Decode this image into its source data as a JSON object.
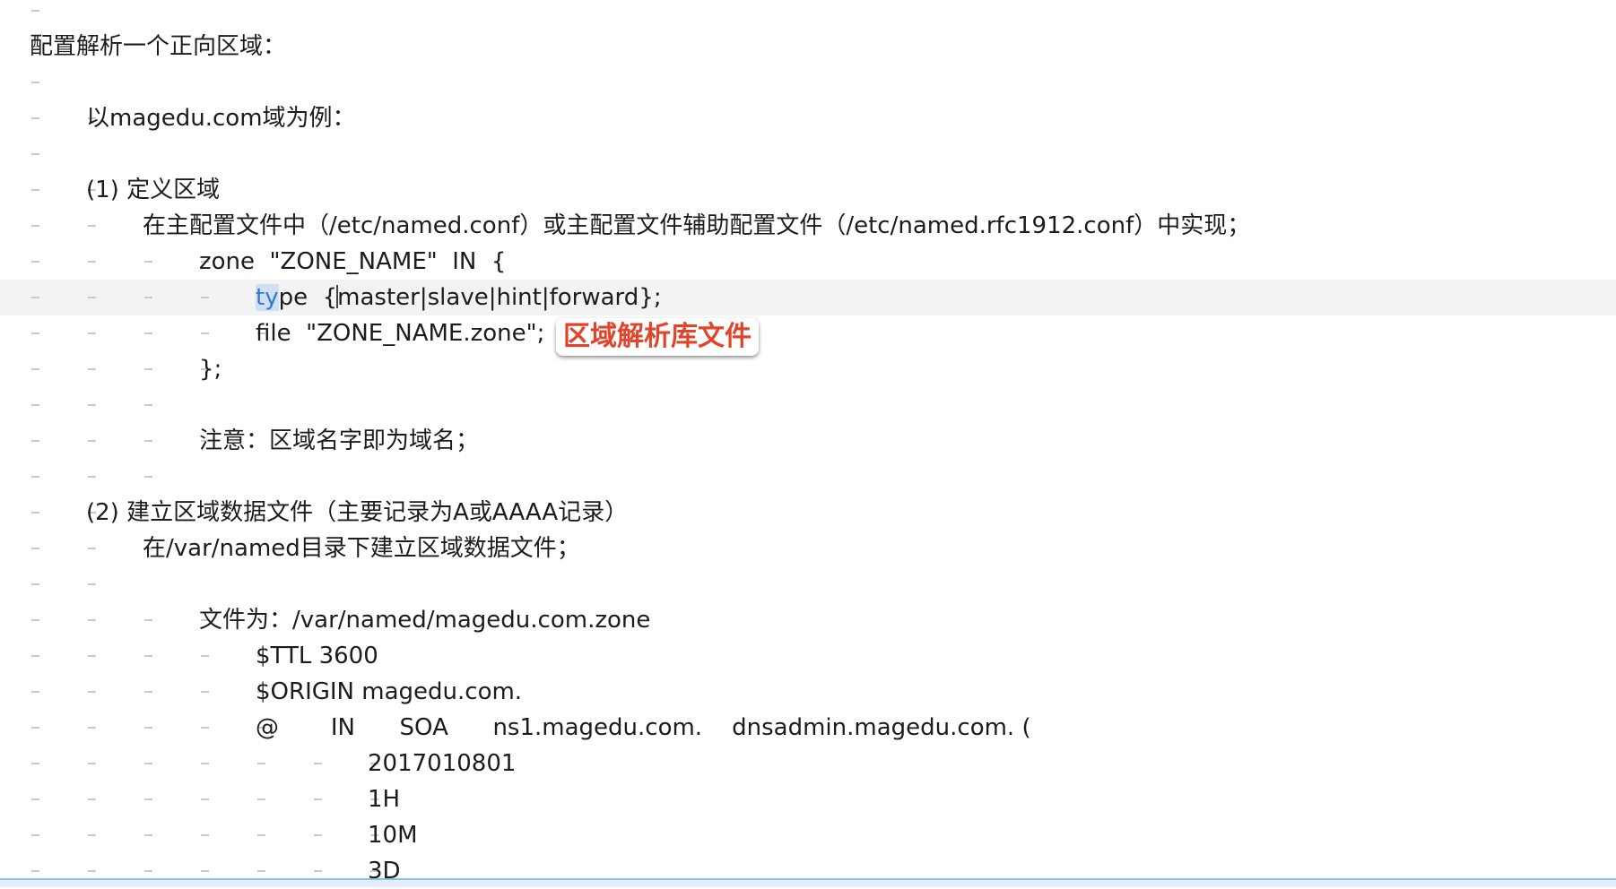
{
  "editor": {
    "lines": [
      {
        "text": "",
        "indent": 0
      },
      {
        "text": "配置解析一个正向区域：",
        "indent": 0
      },
      {
        "text": "",
        "indent": 0
      },
      {
        "text": "以magedu.com域为例：",
        "indent": 1
      },
      {
        "text": "",
        "indent": 0
      },
      {
        "text": "(1) 定义区域",
        "indent": 1
      },
      {
        "text": "在主配置文件中（/etc/named.conf）或主配置文件辅助配置文件（/etc/named.rfc1912.conf）中实现；",
        "indent": 2
      },
      {
        "text": "zone  \"ZONE_NAME\"  IN  {",
        "indent": 3
      },
      {
        "text": "type  {master|slave|hint|forward};",
        "indent": 4,
        "current": true
      },
      {
        "text": "file  \"ZONE_NAME.zone\";",
        "indent": 4
      },
      {
        "text": "};",
        "indent": 3
      },
      {
        "text": "",
        "indent": 0
      },
      {
        "text": "注意：区域名字即为域名；",
        "indent": 3
      },
      {
        "text": "",
        "indent": 0
      },
      {
        "text": "(2) 建立区域数据文件（主要记录为A或AAAA记录）",
        "indent": 1
      },
      {
        "text": "在/var/named目录下建立区域数据文件；",
        "indent": 2
      },
      {
        "text": "",
        "indent": 0
      },
      {
        "text": "文件为：/var/named/magedu.com.zone",
        "indent": 3
      },
      {
        "text": "$TTL 3600",
        "indent": 4
      },
      {
        "text": "$ORIGIN magedu.com.",
        "indent": 4
      },
      {
        "text": "@       IN      SOA      ns1.magedu.com.    dnsadmin.magedu.com. (",
        "indent": 4
      },
      {
        "text": "2017010801",
        "indent": 6
      },
      {
        "text": "1H",
        "indent": 6
      },
      {
        "text": "10M",
        "indent": 6
      },
      {
        "text": "3D",
        "indent": 6
      }
    ],
    "selection": "ty",
    "annotation": "区域解析库文件"
  }
}
